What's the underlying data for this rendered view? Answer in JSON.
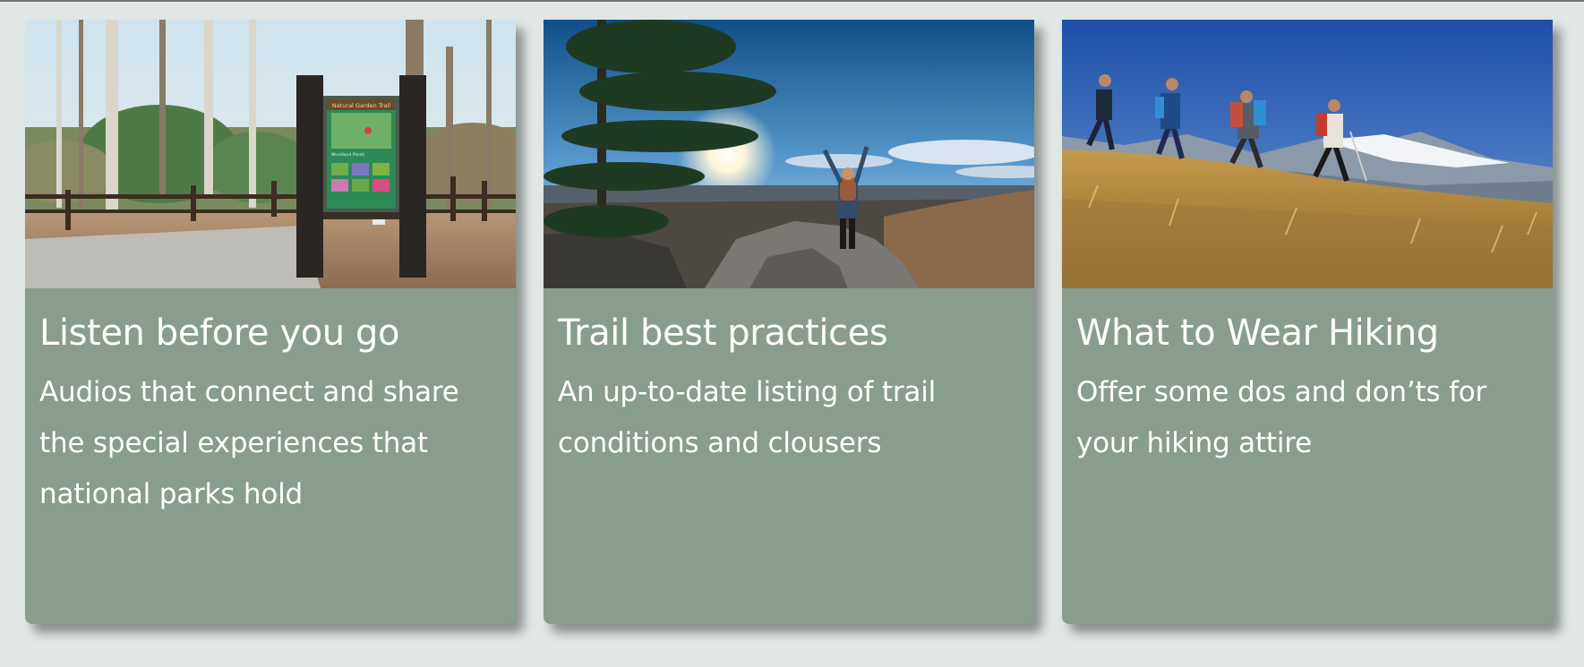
{
  "cards": [
    {
      "title": "Listen before you go",
      "description": "Audios that connect and share the special experiences that national parks hold",
      "image_subject": "Natural Garden Trail sign in a forest",
      "sign_text": "Natural Garden Trail",
      "sign_subtext": "Woodland Plants"
    },
    {
      "title": "Trail best practices",
      "description": "An up-to-date listing of trail conditions and clousers",
      "image_subject": "Hiker with raised arms on a rocky overlook at sunrise"
    },
    {
      "title": "What to Wear Hiking",
      "description": "Offer some dos and don’ts for your hiking attire",
      "image_subject": "Four hikers walking across a grassy ridge with mountains behind"
    }
  ],
  "colors": {
    "page_background": "#e1e7e5",
    "card_background": "#889d8d",
    "card_text": "#ffffff"
  }
}
